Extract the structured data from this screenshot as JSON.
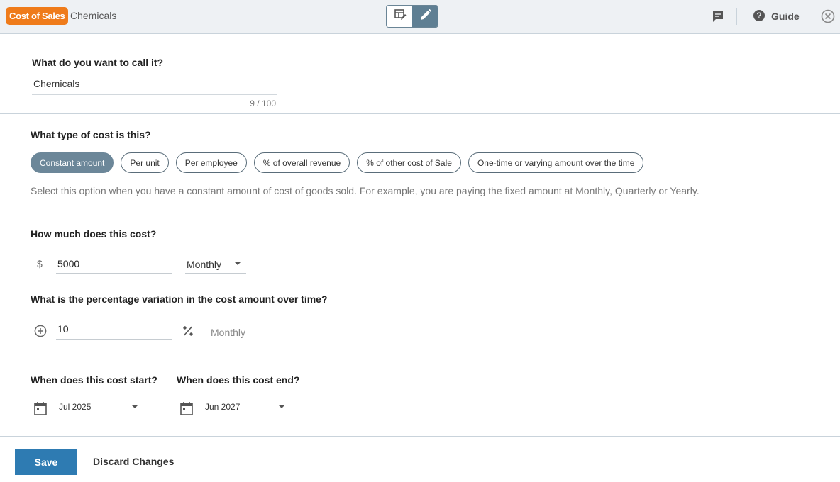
{
  "header": {
    "badge": "Cost of Sales",
    "title": "Chemicals",
    "guide_label": "Guide",
    "icons": [
      "table-edit-icon",
      "pencil-icon",
      "feedback-icon",
      "help-icon",
      "close-icon"
    ]
  },
  "name_section": {
    "question": "What do you want to call it?",
    "value": "Chemicals",
    "counter": "9 / 100"
  },
  "type_section": {
    "question": "What type of cost is this?",
    "options": [
      "Constant amount",
      "Per unit",
      "Per employee",
      "% of overall revenue",
      "% of other cost of Sale",
      "One-time or varying amount over the time"
    ],
    "selected": "Constant amount",
    "hint": "Select this option when you have a constant amount of cost of goods sold. For example, you are paying the fixed amount at Monthly, Quarterly or Yearly."
  },
  "cost_section": {
    "question": "How much does this cost?",
    "currency": "$",
    "amount": "5000",
    "frequency": "Monthly",
    "variation_question": "What is the percentage variation in the cost amount over time?",
    "variation_value": "10",
    "variation_frequency": "Monthly"
  },
  "dates_section": {
    "start_question": "When does this cost start?",
    "start_value": "Jul 2025",
    "end_question": "When does this cost end?",
    "end_value": "Jun 2027"
  },
  "footer": {
    "save_label": "Save",
    "discard_label": "Discard Changes"
  },
  "colors": {
    "badge": "#ef7b1a",
    "active_chip": "#6c8799",
    "save_button": "#2e7bb2"
  }
}
